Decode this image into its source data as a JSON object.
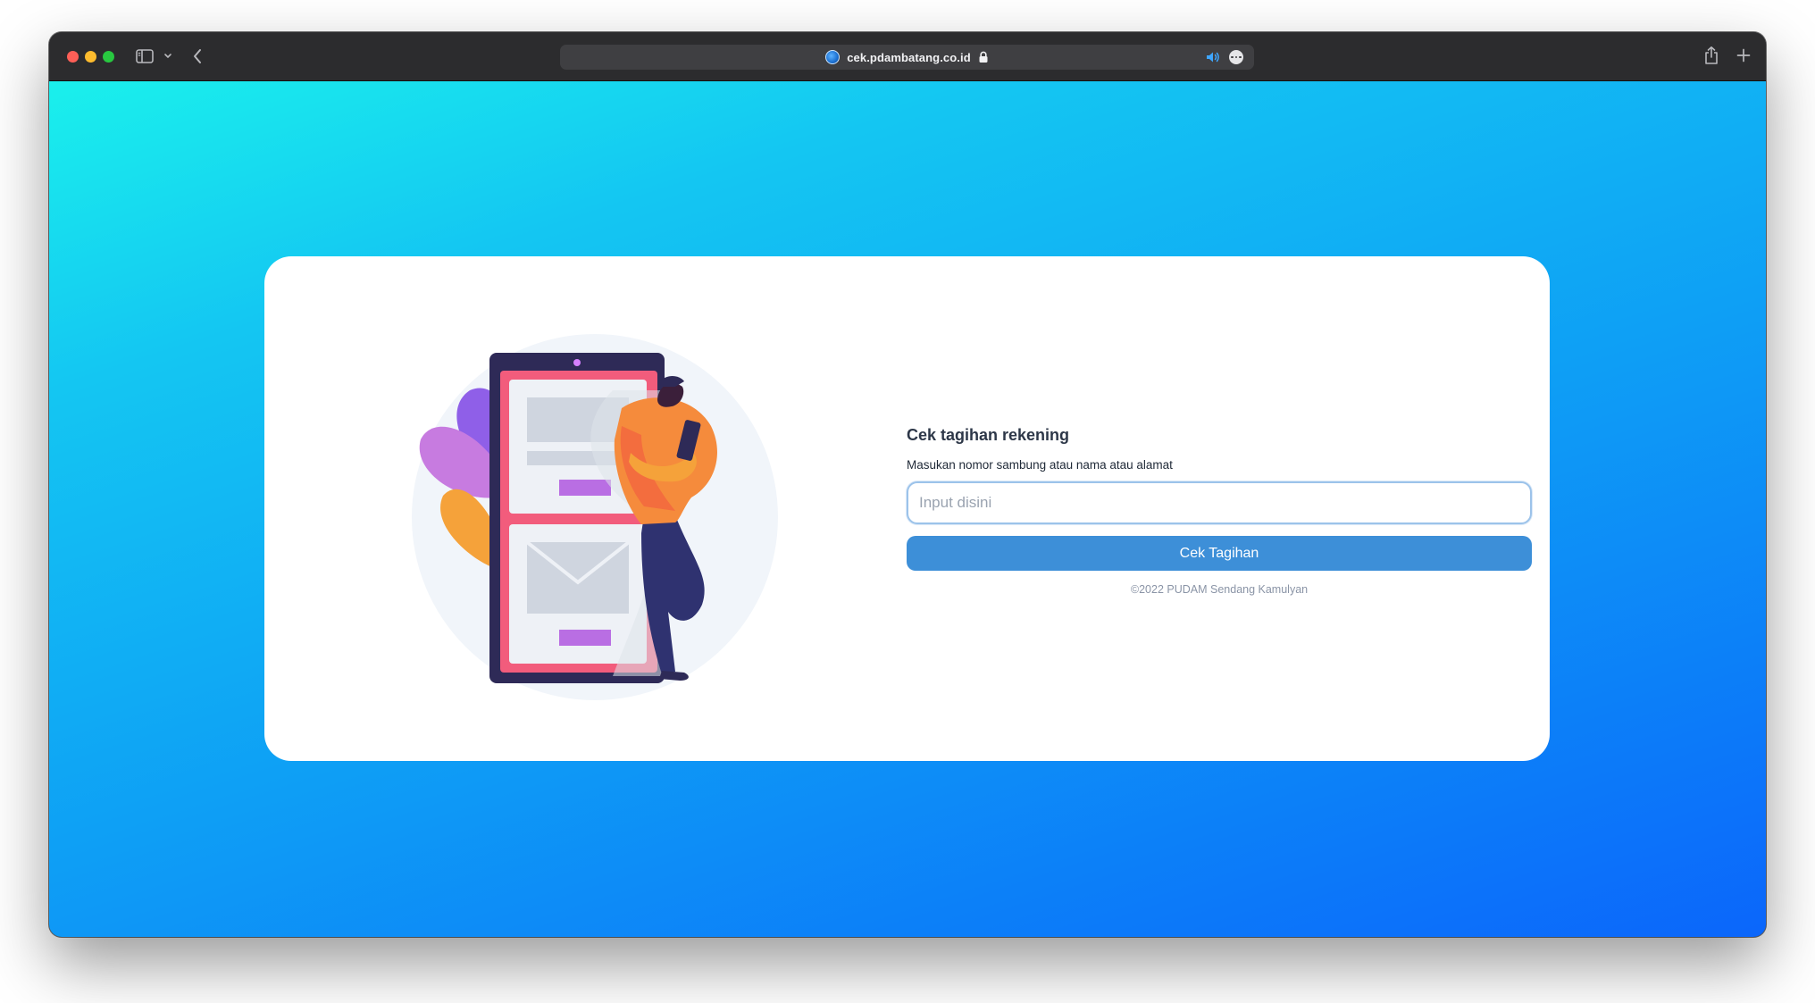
{
  "browser": {
    "url": "cek.pdambatang.co.id",
    "icons": {
      "sidebar": "sidebar-icon",
      "chevron": "chevron-down-icon",
      "back": "chevron-left-icon",
      "favicon": "site-favicon",
      "lock": "lock-icon",
      "speaker": "speaker-icon",
      "more": "more-icon",
      "share": "share-icon",
      "new_tab": "plus-icon"
    }
  },
  "page": {
    "background_colors": [
      "#1af0ec",
      "#0b66fb"
    ],
    "form": {
      "title": "Cek tagihan rekening",
      "label": "Masukan nomor sambung atau nama atau alamat",
      "input_placeholder": "Input disini",
      "input_value": "",
      "submit_label": "Cek Tagihan",
      "footer": "©2022 PUDAM Sendang Kamulyan",
      "accent_color": "#3d8fd8"
    }
  }
}
